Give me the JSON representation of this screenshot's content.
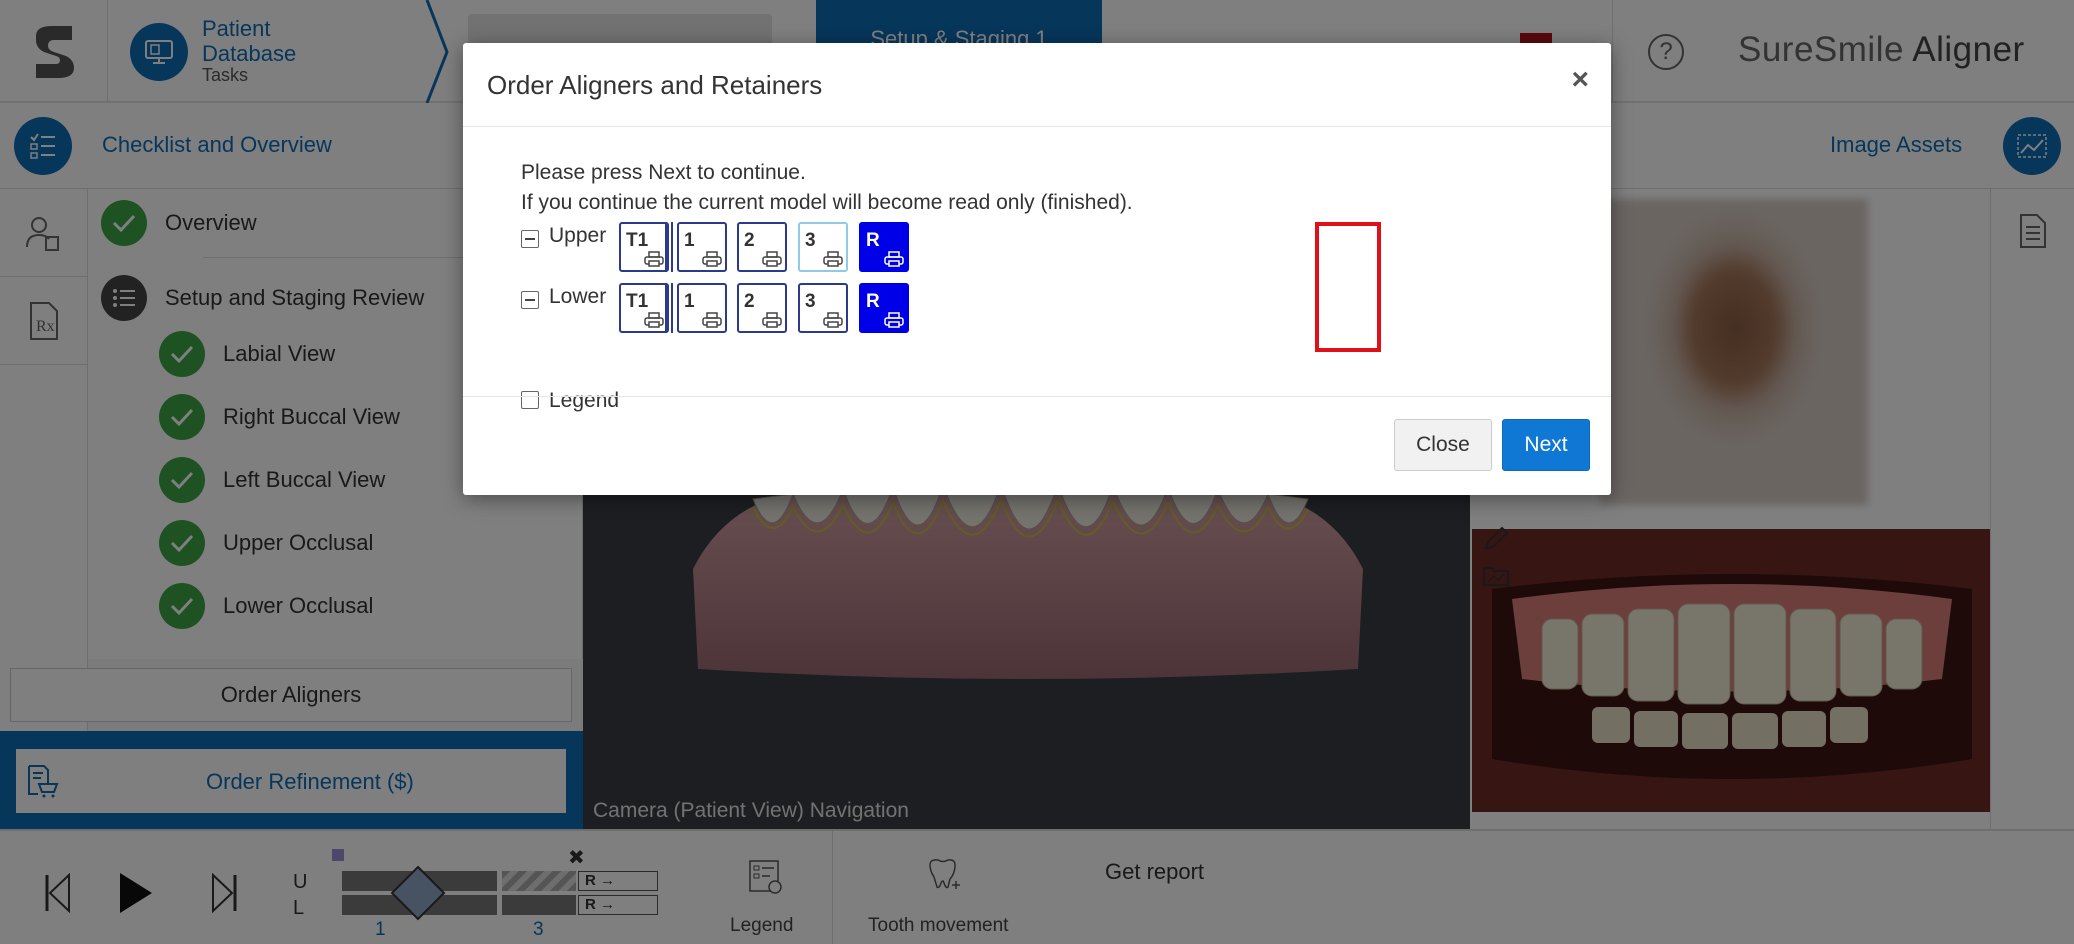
{
  "topbar": {
    "patient_line1": "Patient",
    "patient_line2": "Database",
    "patient_sub": "Tasks",
    "active_tab": "Setup & Staging 1",
    "help": "?",
    "brand_light": "SureSmile",
    "brand_bold": "Aligner"
  },
  "subbar": {
    "checklist_title": "Checklist and Overview",
    "image_assets": "Image Assets"
  },
  "checklist": {
    "overview": "Overview",
    "setup_review": "Setup and Staging Review",
    "items": [
      "Labial View",
      "Right Buccal View",
      "Left Buccal View",
      "Upper Occlusal",
      "Lower Occlusal"
    ]
  },
  "left_panel": {
    "order_aligners": "Order Aligners",
    "order_refinement": "Order Refinement ($)"
  },
  "viewport": {
    "label": "Camera (Patient View) Navigation"
  },
  "bottom": {
    "upper_letter": "U",
    "lower_letter": "L",
    "r_upper": "R →",
    "r_lower": "R →",
    "stage_start": "1",
    "stage_end": "3",
    "legend_label": "Legend",
    "tooth_movement": "Tooth movement",
    "get_report": "Get report"
  },
  "modal": {
    "title": "Order Aligners and Retainers",
    "close_x": "×",
    "message1": "Please press Next to continue.",
    "message2": "If you continue the current model will become read only (finished).",
    "upper_label": "Upper",
    "lower_label": "Lower",
    "stages": [
      "T1",
      "1",
      "2",
      "3",
      "R"
    ],
    "legend_label": "Legend",
    "close_button": "Close",
    "next_button": "Next"
  },
  "colors": {
    "brand_blue": "#0f6db7",
    "check_green": "#3ca447",
    "selected_stage": "#0000e8",
    "highlight_red": "#e0101a"
  }
}
